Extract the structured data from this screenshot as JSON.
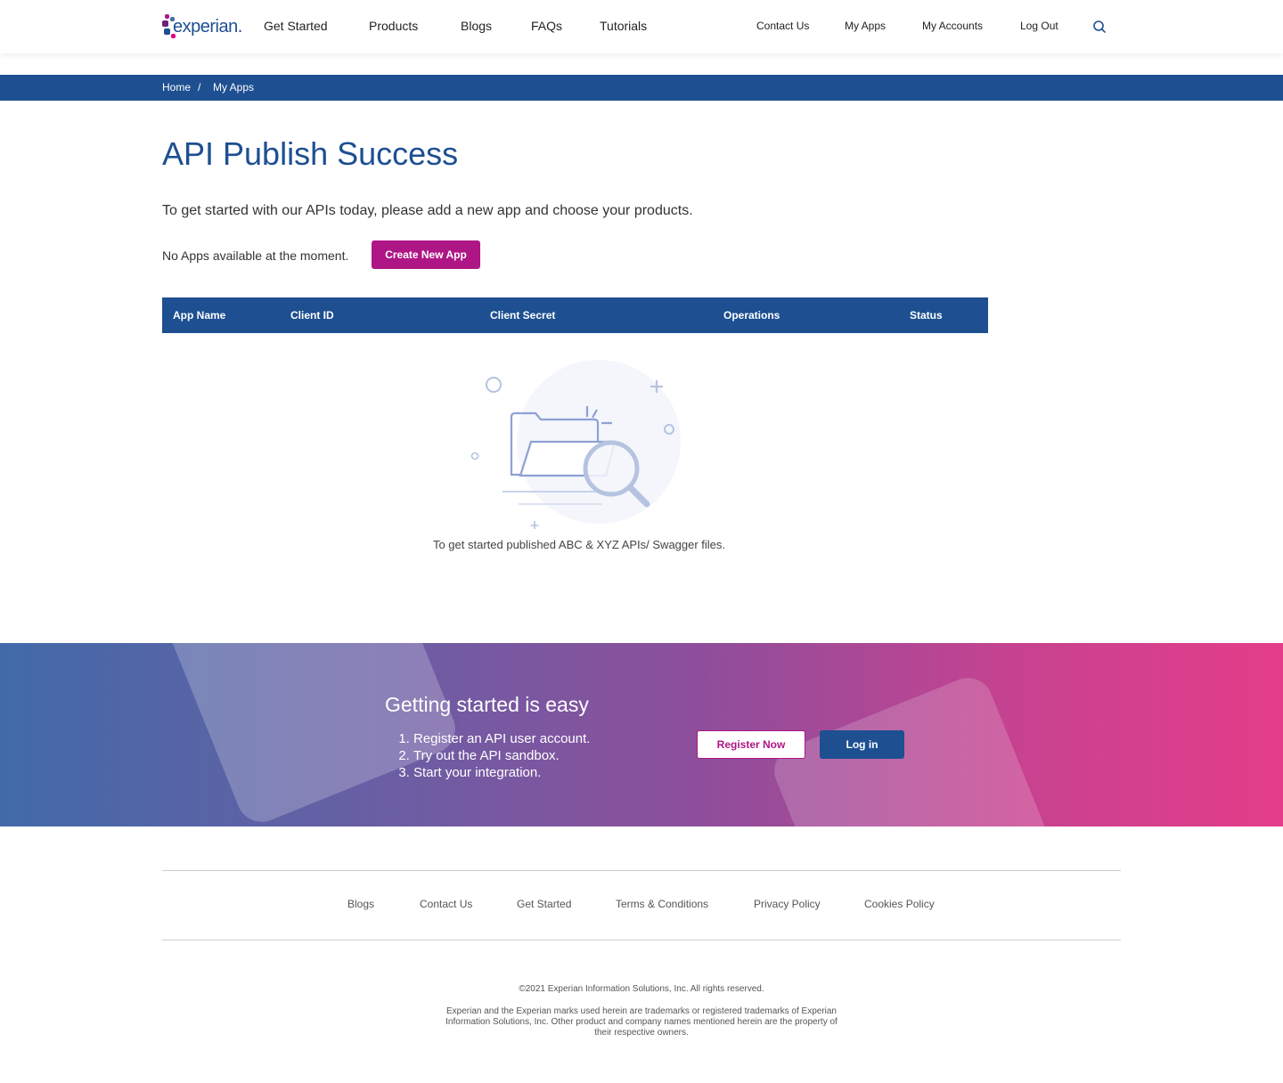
{
  "brand": {
    "logo_text": "experian.",
    "primary_color": "#1d4f91",
    "accent_color": "#af1685"
  },
  "nav": {
    "main": [
      "Get Started",
      "Products",
      "Blogs",
      "FAQs",
      "Tutorials"
    ],
    "right": [
      "Contact Us",
      "My Apps",
      "My Accounts",
      "Log Out"
    ],
    "search_icon": "search-icon"
  },
  "breadcrumb": {
    "home": "Home",
    "separator": "/",
    "current": "My Apps"
  },
  "main": {
    "title": "API Publish Success",
    "intro": "To get started with our APIs today, please add a new app and choose your products.",
    "no_apps": "No Apps available at the moment.",
    "create_button": "Create New App",
    "table_headers": [
      "App Name",
      "Client ID",
      "Client Secret",
      "Operations",
      "Status"
    ],
    "empty_message": "To get started published ABC & XYZ APIs/ Swagger files."
  },
  "banner": {
    "title": "Getting started is easy",
    "steps": [
      "Register an API user account.",
      "Try out the API sandbox.",
      "Start your integration."
    ],
    "register_button": "Register Now",
    "login_button": "Log in"
  },
  "footer": {
    "links": [
      "Blogs",
      "Contact Us",
      "Get Started",
      "Terms & Conditions",
      "Privacy Policy",
      "Cookies Policy"
    ],
    "copyright": "©2021 Experian Information Solutions, Inc. All rights reserved.",
    "legal": "Experian and the Experian marks used herein are trademarks or registered trademarks of Experian Information Solutions, Inc. Other product and company names mentioned herein are the property of their respective owners."
  }
}
